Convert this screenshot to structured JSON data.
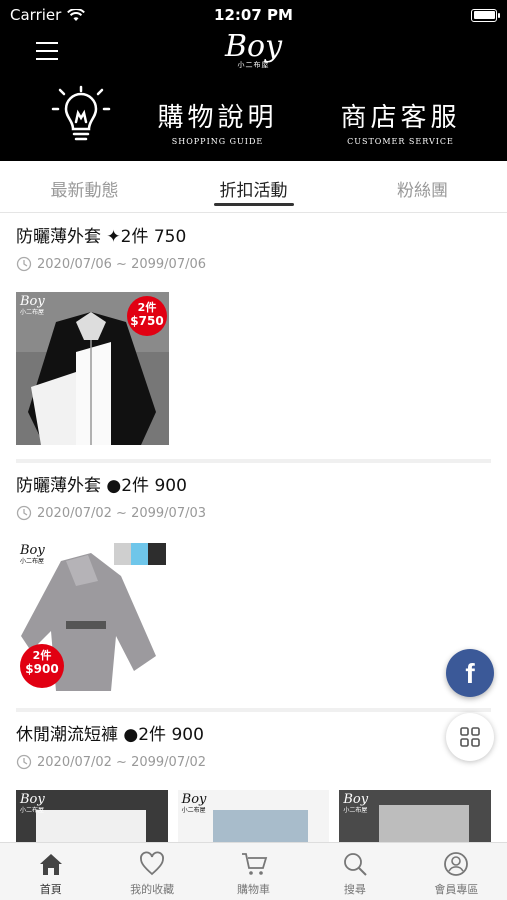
{
  "status_bar": {
    "carrier": "Carrier",
    "time": "12:07 PM"
  },
  "header": {
    "logo_text": "Boy",
    "logo_sub": "小二布屋"
  },
  "banner": {
    "guide": {
      "zh": "購物說明",
      "en": "SHOPPING GUIDE"
    },
    "service": {
      "zh": "商店客服",
      "en": "CUSTOMER SERVICE"
    }
  },
  "tabs": [
    {
      "label": "最新動態",
      "active": false
    },
    {
      "label": "折扣活動",
      "active": true
    },
    {
      "label": "粉絲團",
      "active": false
    }
  ],
  "posts": [
    {
      "title": "防曬薄外套 ✦2件 750",
      "date": "2020/07/06 ~ 2099/07/06",
      "badge": {
        "line1": "2件",
        "line2": "$750"
      },
      "thumb_logo": "Boy",
      "thumb_logo_sub": "小二布屋"
    },
    {
      "title": "防曬薄外套 ●2件 900",
      "date": "2020/07/02 ~ 2099/07/03",
      "badge": {
        "line1": "2件",
        "line2": "$900"
      },
      "thumb_logo": "Boy",
      "thumb_logo_sub": "小二布屋"
    },
    {
      "title": "休閒潮流短褲 ●2件 900",
      "date": "2020/07/02 ~ 2099/07/02",
      "thumb_logo": "Boy",
      "thumb_logo_sub": "小二布屋"
    }
  ],
  "floating": {
    "facebook_label": "f"
  },
  "bottom_nav": [
    {
      "label": "首頁",
      "icon": "home-icon",
      "active": true
    },
    {
      "label": "我的收藏",
      "icon": "heart-icon",
      "active": false
    },
    {
      "label": "購物車",
      "icon": "cart-icon",
      "active": false
    },
    {
      "label": "搜尋",
      "icon": "search-icon",
      "active": false
    },
    {
      "label": "會員專區",
      "icon": "user-icon",
      "active": false
    }
  ],
  "colors": {
    "header_bg": "#000000",
    "promo_red": "#e10012",
    "facebook_blue": "#3b5998",
    "tab_active": "#333333"
  }
}
